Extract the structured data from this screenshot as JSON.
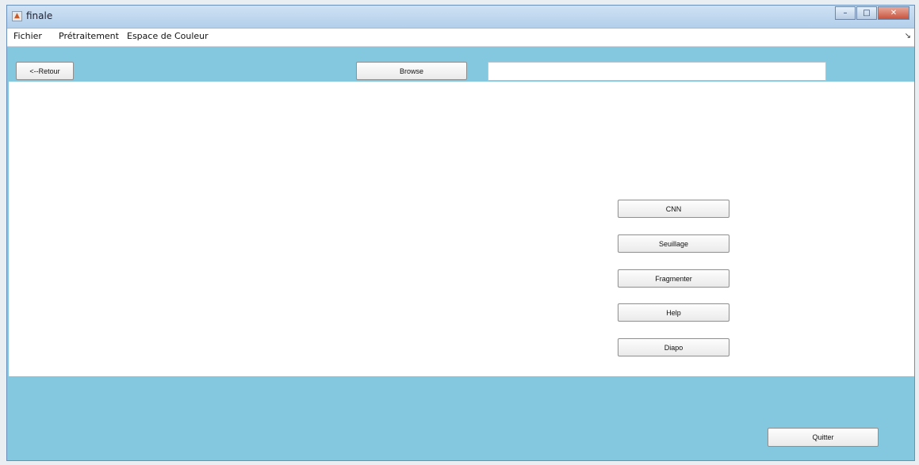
{
  "window": {
    "title": "finale",
    "controls": {
      "minimize": "–",
      "maximize": "□",
      "close": "✕"
    }
  },
  "menubar": {
    "items": [
      "Fichier",
      "Prétraitement",
      "Espace de Couleur"
    ],
    "pin": "↘"
  },
  "toolbar": {
    "back_label": "<--Retour",
    "browse_label": "Browse",
    "path_value": ""
  },
  "actions": {
    "cnn_label": "CNN",
    "seuillage_label": "Seuillage",
    "fragmenter_label": "Fragmenter",
    "help_label": "Help",
    "diapo_label": "Diapo"
  },
  "footer": {
    "quit_label": "Quitter"
  },
  "colors": {
    "panel_bg": "#84c8e0",
    "canvas_bg": "#ffffff",
    "titlebar": "#b3cfea"
  }
}
